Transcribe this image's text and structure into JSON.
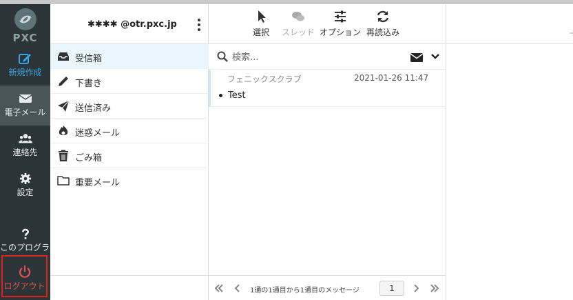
{
  "app": {
    "logo_text": "PXC"
  },
  "nav": {
    "compose": "新規作成",
    "mail": "電子メール",
    "contacts": "連絡先",
    "settings": "設定",
    "about": "このプログラ…",
    "logout": "ログアウト"
  },
  "account": {
    "name": "✱✱✱✱ @otr.pxc.jp"
  },
  "folders": [
    {
      "label": "受信箱",
      "icon": "inbox-icon"
    },
    {
      "label": "下書き",
      "icon": "pencil-icon"
    },
    {
      "label": "送信済み",
      "icon": "paper-plane-icon"
    },
    {
      "label": "迷惑メール",
      "icon": "fire-icon"
    },
    {
      "label": "ごみ箱",
      "icon": "trash-icon"
    },
    {
      "label": "重要メール",
      "icon": "folder-icon"
    }
  ],
  "toolbar": {
    "select": "選択",
    "thread": "スレッド",
    "options": "オプション",
    "refresh": "再読込み"
  },
  "search": {
    "placeholder": "検索..."
  },
  "messages": [
    {
      "from": "フェニックスクラブ",
      "date": "2021-01-26 11:47",
      "subject": "Test"
    }
  ],
  "pager": {
    "text": "1通の1通目から1通目のメッセージ",
    "page": "1"
  },
  "preview": {
    "truncated": "ー"
  },
  "colors": {
    "nav_bg": "#2b3436",
    "accent": "#36a7e6",
    "logout": "#e65050",
    "active_folder": "#e9f6fd"
  }
}
